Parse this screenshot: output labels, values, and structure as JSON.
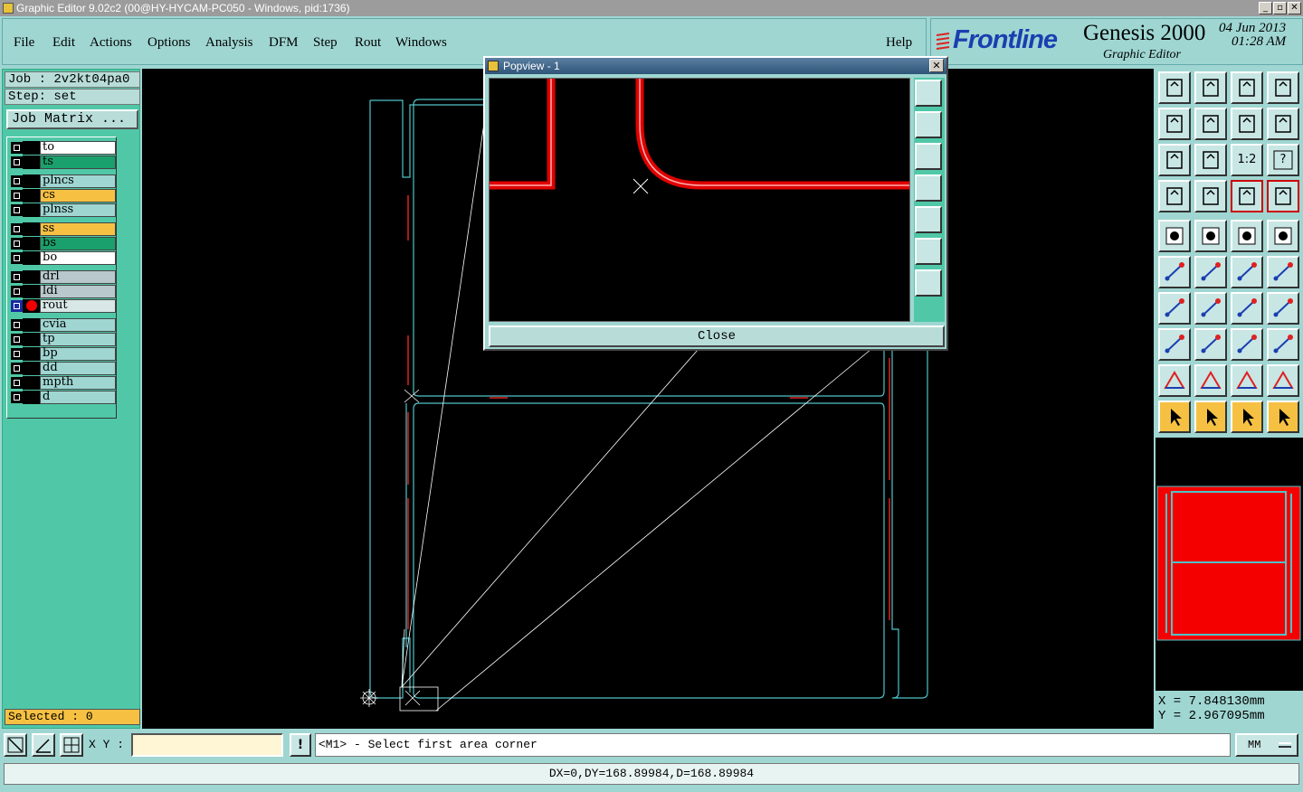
{
  "window": {
    "title": "Graphic Editor 9.02c2 (00@HY-HYCAM-PC050 - Windows, pid:1736)",
    "min": "_",
    "max": "▫",
    "close": "✕"
  },
  "menu": {
    "items": [
      "File",
      "Edit",
      "Actions",
      "Options",
      "Analysis",
      "DFM",
      "Step",
      "Rout",
      "Windows"
    ],
    "help": "Help"
  },
  "brand": {
    "logo": "Frontline",
    "product": "Genesis 2000",
    "subtitle": "Graphic Editor",
    "date": "04 Jun 2013",
    "time": "01:28 AM",
    "logo_color": "#1a3fb0"
  },
  "job": {
    "job_label": "Job : 2v2kt04pa0",
    "step_label": "Step: set",
    "matrix_button": "Job Matrix ...",
    "selected": "Selected : 0"
  },
  "layers": [
    {
      "name": "to",
      "color": "#ffffff"
    },
    {
      "name": "ts",
      "color": "#1aa06c"
    },
    {
      "name": "plncs",
      "color": "#9fd6d2"
    },
    {
      "name": "cs",
      "color": "#f6c143"
    },
    {
      "name": "plnss",
      "color": "#9fd6d2"
    },
    {
      "name": "ss",
      "color": "#f6c143"
    },
    {
      "name": "bs",
      "color": "#1aa06c"
    },
    {
      "name": "bo",
      "color": "#ffffff"
    },
    {
      "name": "drl",
      "color": "#b8c8cc"
    },
    {
      "name": "ldi",
      "color": "#b8c8cc"
    },
    {
      "name": "rout",
      "color": "#d8e8e6",
      "active": true
    },
    {
      "name": "cvia",
      "color": "#9fd6d2"
    },
    {
      "name": "tp",
      "color": "#9fd6d2"
    },
    {
      "name": "bp",
      "color": "#9fd6d2"
    },
    {
      "name": "dd",
      "color": "#9fd6d2"
    },
    {
      "name": "mpth",
      "color": "#9fd6d2"
    },
    {
      "name": "d",
      "color": "#9fd6d2"
    }
  ],
  "popview": {
    "title": "Popview - 1",
    "close_button": "Close",
    "close_x": "✕"
  },
  "toolbar": {
    "ratio_label": "1:2",
    "help_label": "?"
  },
  "coords": {
    "x": "X = 7.848130mm",
    "y": "Y = 2.967095mm"
  },
  "bottom": {
    "xy_label": "X Y :",
    "xy_value": "",
    "bang": "!",
    "prompt": "<M1> - Select first area corner",
    "units": "MM"
  },
  "status": {
    "text": "DX=0,DY=168.89984,D=168.89984"
  }
}
